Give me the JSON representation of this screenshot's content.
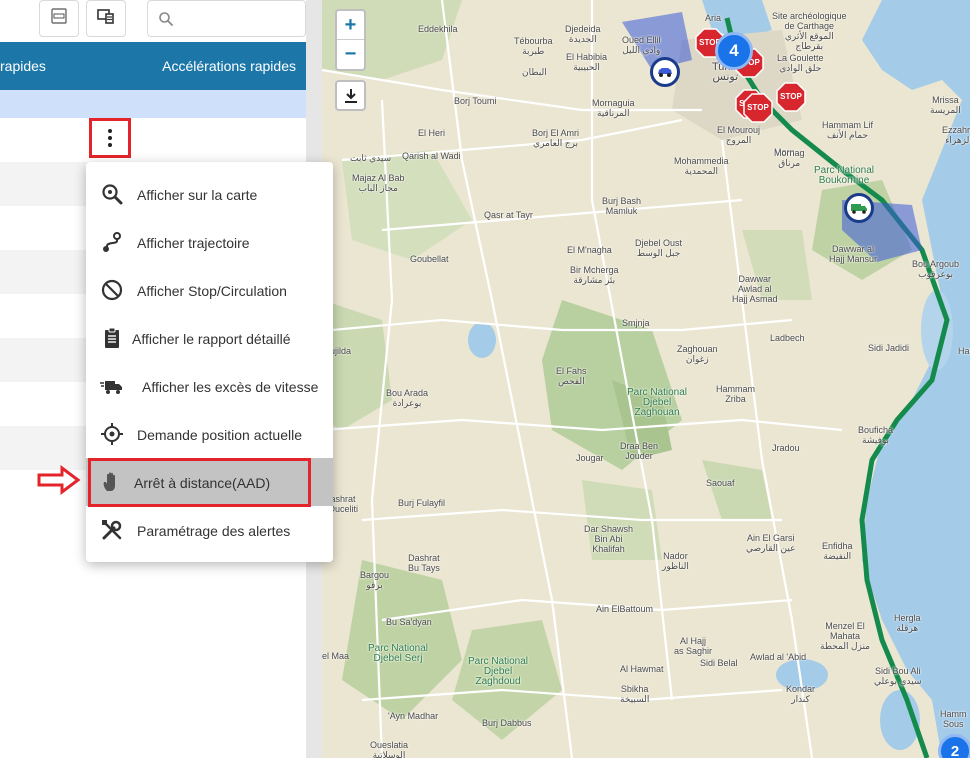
{
  "toolbar": {
    "xlsx_icon": "xlsx-export-icon",
    "layout_icon": "layout-toggle-icon",
    "search_placeholder": "",
    "search_value": ""
  },
  "table": {
    "headers": [
      "rapides",
      "Accélérations rapides"
    ]
  },
  "context_menu": {
    "items": [
      {
        "label": "Afficher sur la carte",
        "icon": "zoom-map-icon"
      },
      {
        "label": "Afficher trajectoire",
        "icon": "route-icon"
      },
      {
        "label": "Afficher Stop/Circulation",
        "icon": "block-icon"
      },
      {
        "label": "Afficher le rapport détaillé",
        "icon": "clipboard-icon"
      },
      {
        "label": "Afficher les excès de vitesse",
        "icon": "truck-speed-icon"
      },
      {
        "label": "Demande position actuelle",
        "icon": "crosshair-icon"
      },
      {
        "label": "Arrêt à distance(AAD)",
        "icon": "hand-icon"
      },
      {
        "label": "Paramétrage des alertes",
        "icon": "tools-icon"
      }
    ],
    "highlighted_item": "Arrêt à distance(AAD)"
  },
  "map": {
    "zoom_in": "+",
    "zoom_out": "−",
    "stop_label": "STOP",
    "clusters": [
      "4",
      "2"
    ],
    "labels": {
      "ariana": "Aria",
      "site": "Site archéologique\nde Carthage\nالموقع الأثري\nبقرطاج",
      "goulette": "La Goulette\nحلق الوادي",
      "eddekhila": "Eddekhila",
      "tebourba": "Tébourba\nطبربة",
      "djedeida": "Djedeida\nالجديدة",
      "habibia": "El Habibia\nالحبيبية",
      "battan": "البطان",
      "ouedellil": "Oued Ellil\nوادي الليل",
      "tunis": "Tunis\nتونس",
      "mrissa": "Mrissa\nالمريسة",
      "kelibia": "Ezzahra\nالزهراء",
      "morn": "Morn",
      "bordjtoumi": "Borj Toumi",
      "mornaguia": "Mornaguia\nالمرناقية",
      "mourouj": "El Mourouj\nالمروج",
      "hammamlif": "Hammam Lif\nحمام الأنف",
      "elheri": "El Heri",
      "sidithabet": "سيدي ثابت",
      "borjamri": "Borj El Amri\nبرج العامري",
      "qarish": "Qarish al Wadi",
      "mohammedia": "Mohammedia\nالمحمدية",
      "mornag": "Mornag\nمرناق",
      "bouguirine": "Parc National\nBoukornine",
      "majaz": "Majaz Al Bab\nمجاز الباب",
      "qasr": "Qasr at Tayr",
      "bourjbash": "Burj Bash\nMamluk",
      "dawwar": "Dawwar al\nHajj Mansur",
      "djebeloust": "Djebel Oust\nجبل الوسط",
      "elmnagha": "El M'nagha",
      "dawwarawlad": "Dawwar\nAwlad al\nHajj Asmad",
      "bouargoub": "Bou Argoub\nبوعرقوب",
      "goubellat": "Goubellat",
      "birmcherga": "Bir Mcherga\nبئر مشارقة",
      "smjnja": "Smjnja",
      "ladbech": "Ladbech",
      "sidijedidi": "Sidi Jadidi",
      "hama": "Ham",
      "tajilda": "ujilda",
      "zaghouan": "Zaghouan\nزغوان",
      "bouarada": "Bou Arada\nبوعرادة",
      "elfahs": "El Fahs\nالفحص",
      "parczag": "Parc National\nDjebel\nZaghouan",
      "hammamzriba": "Hammam\nZriba",
      "bouficha": "Bouficha\nبوفيشة",
      "jradou": "Jradou",
      "jougar": "Jougar",
      "draaben": "Draa Ben\nJouder",
      "saouaf": "Saouaf",
      "dashrat": "ashrat\nOuceliti",
      "burjfulayfil": "Burj Fulayfil",
      "darshawsh": "Dar Shawsh\nBin Abi\nKhalifah",
      "ainelgarsi": "Ain El Garsi\nعين القارصي",
      "enfidha": "Enfidha\nالنفيضة",
      "nador": "Nador\nالناظور",
      "dashratbt": "Dashrat\nBu Tays",
      "bargou": "Bargou\nبرقو",
      "aineltbattoum": "Ain ElBattoum",
      "busayan": "Bu Sa'dyan",
      "hergla": "Hergla\nهرقلة",
      "menzel": "Menzel El\nMahata\nمنزل المحطة",
      "elmaa": "el Maa",
      "parcserj": "Parc National\nDjebel Serj",
      "parczaghdoud": "Parc National\nDjebel\nZaghdoud",
      "alhajj": "Al Hajj\nas Saghir",
      "sidibelal": "Sidi Belal",
      "awladabid": "Awlad al 'Abid",
      "sidibouali": "Sidi Bou Ali\nسيدي بوعلي",
      "alhawmat": "Al Hawmat",
      "sbikha": "Sbikha\nالسبيخة",
      "kondar": "Kondar\nكندار",
      "ainmadhar": "'Ayn Madhar",
      "burjdabbus": "Burj Dabbus",
      "hammamsousse": "Hamm\nSous",
      "oueslatia": "Oueslatia\nالوسلاتية"
    }
  }
}
